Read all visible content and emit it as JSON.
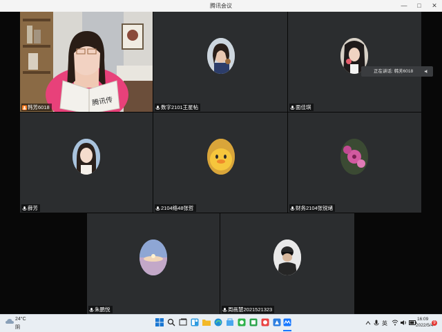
{
  "window": {
    "title": "腾讯会议",
    "minimize": "—",
    "maximize": "□",
    "close": "✕"
  },
  "participants": [
    {
      "name": "韩芳6018",
      "video": "camera",
      "badge": "host-icon",
      "book_title": "腾讯传"
    },
    {
      "name": "数字2101王星帖",
      "video": "avatar"
    },
    {
      "name": "面佳琪",
      "video": "avatar"
    },
    {
      "name": "薛芳",
      "video": "avatar"
    },
    {
      "name": "2104络48张哲",
      "video": "avatar"
    },
    {
      "name": "财务2104张锐绪",
      "video": "avatar"
    },
    {
      "name": "朱鹏悦",
      "video": "avatar"
    },
    {
      "name": "周画慧2021521323",
      "video": "avatar"
    }
  ],
  "speaking": {
    "label": "正在讲话: 韩芳6018",
    "icon": "speaker-icon"
  },
  "taskbar": {
    "weather_temp": "24°C",
    "weather_desc": "阴",
    "ime": "英",
    "time": "16:09",
    "date": "2022/5/4",
    "notifications": "9"
  }
}
